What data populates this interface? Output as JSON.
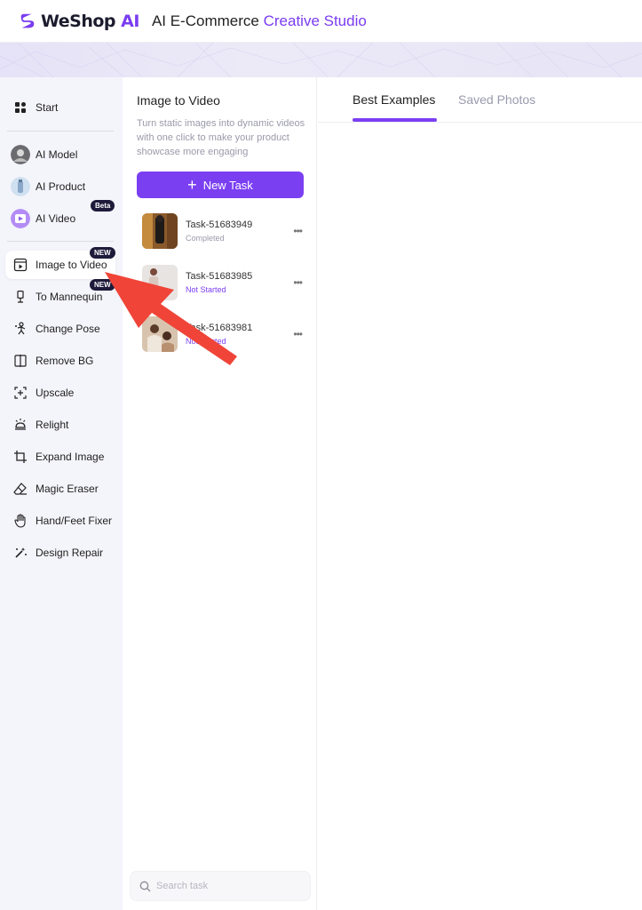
{
  "header": {
    "logo_we": "WeShop",
    "logo_ai": "AI",
    "title_prefix": "AI E-Commerce",
    "title_accent": "Creative Studio"
  },
  "sidebar": {
    "start": "Start",
    "ai_model": "AI Model",
    "ai_product": "AI Product",
    "ai_video": "AI Video",
    "ai_video_badge": "Beta",
    "image_to_video": "Image to Video",
    "image_to_video_badge": "NEW",
    "to_mannequin": "To Mannequin",
    "to_mannequin_badge": "NEW",
    "change_pose": "Change Pose",
    "remove_bg": "Remove BG",
    "upscale": "Upscale",
    "relight": "Relight",
    "expand_image": "Expand Image",
    "magic_eraser": "Magic Eraser",
    "hand_feet_fixer": "Hand/Feet Fixer",
    "design_repair": "Design Repair"
  },
  "task_panel": {
    "title": "Image to Video",
    "description": "Turn static images into dynamic videos with one click to make your product showcase more engaging",
    "new_task_label": "New Task",
    "tasks": [
      {
        "name": "Task-51683949",
        "status": "Completed",
        "status_color": "#9a9aaa"
      },
      {
        "name": "Task-51683985",
        "status": "Not Started",
        "status_color": "#7b3ff2"
      },
      {
        "name": "Task-51683981",
        "status": "Not Started",
        "status_color": "#7b3ff2"
      }
    ],
    "search_placeholder": "Search task"
  },
  "main": {
    "tabs": [
      {
        "label": "Best Examples",
        "active": true
      },
      {
        "label": "Saved Photos",
        "active": false
      }
    ]
  },
  "colors": {
    "accent": "#7b3ff2",
    "badge_bg": "#1d1a3a",
    "annotation_arrow": "#f04438"
  }
}
